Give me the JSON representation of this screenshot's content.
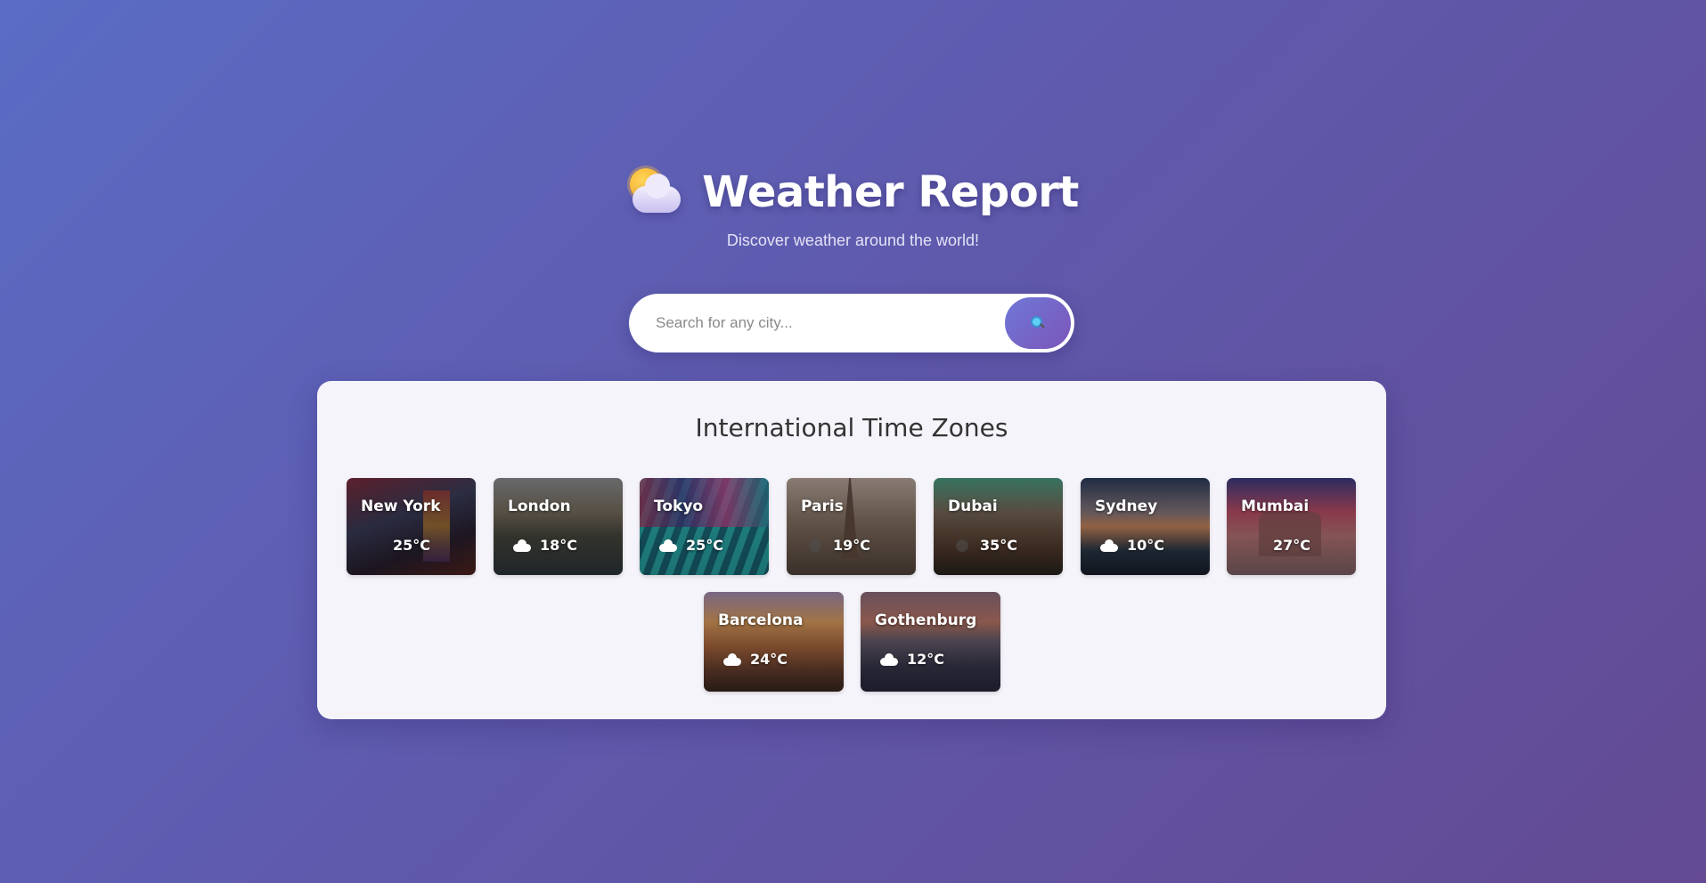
{
  "header": {
    "title": "Weather Report",
    "subtitle": "Discover weather around the world!",
    "logo_icon": "sun-behind-cloud-icon"
  },
  "search": {
    "placeholder": "Search for any city...",
    "value": "",
    "button_icon": "magnifier-icon"
  },
  "panel": {
    "title": "International Time Zones",
    "cities": [
      {
        "name": "New York",
        "temp": "25°C",
        "icon": "none"
      },
      {
        "name": "London",
        "temp": "18°C",
        "icon": "cloud-icon"
      },
      {
        "name": "Tokyo",
        "temp": "25°C",
        "icon": "cloud-icon"
      },
      {
        "name": "Paris",
        "temp": "19°C",
        "icon": "clear-icon"
      },
      {
        "name": "Dubai",
        "temp": "35°C",
        "icon": "clear-icon"
      },
      {
        "name": "Sydney",
        "temp": "10°C",
        "icon": "cloud-icon"
      },
      {
        "name": "Mumbai",
        "temp": "27°C",
        "icon": "none"
      },
      {
        "name": "Barcelona",
        "temp": "24°C",
        "icon": "cloud-icon"
      },
      {
        "name": "Gothenburg",
        "temp": "12°C",
        "icon": "cloud-icon"
      }
    ]
  },
  "colors": {
    "background_start": "#5a6cc4",
    "background_end": "#634a93",
    "panel": "#f5f4fa",
    "search_button": "#7060c8"
  }
}
